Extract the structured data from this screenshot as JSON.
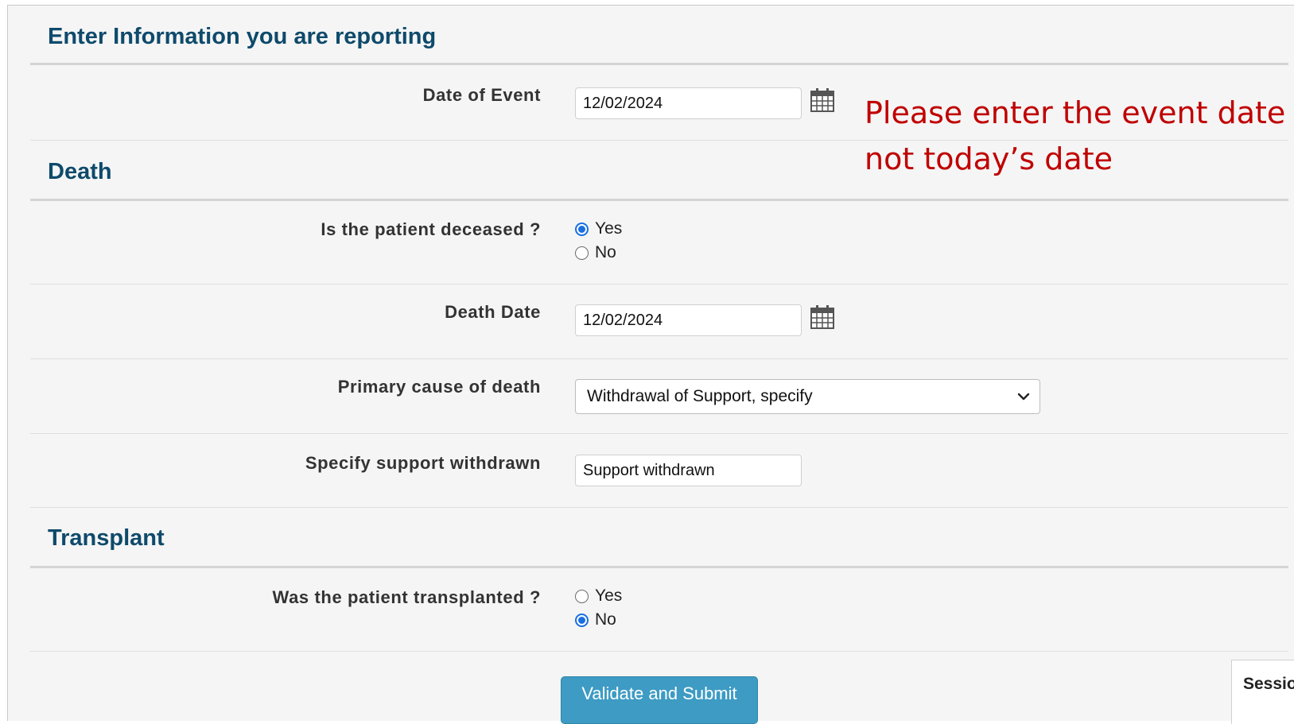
{
  "sections": {
    "reporting_title": "Enter Information you are reporting",
    "death_title": "Death",
    "transplant_title": "Transplant"
  },
  "fields": {
    "event_date": {
      "label": "Date of Event",
      "value": "12/02/2024"
    },
    "deceased": {
      "label": "Is the patient deceased ?",
      "options": [
        "Yes",
        "No"
      ],
      "selected": "Yes"
    },
    "death_date": {
      "label": "Death Date",
      "value": "12/02/2024"
    },
    "primary_cause": {
      "label": "Primary cause of death",
      "selected": "Withdrawal of Support, specify"
    },
    "support_withdrawn": {
      "label": "Specify support withdrawn",
      "value": "Support withdrawn"
    },
    "transplanted": {
      "label": "Was the patient transplanted ?",
      "options": [
        "Yes",
        "No"
      ],
      "selected": "No"
    }
  },
  "annotation": {
    "line1": "Please enter the event date",
    "line2": "not today’s date",
    "color": "#c00000"
  },
  "actions": {
    "submit_label": "Validate and Submit"
  },
  "session_panel": {
    "text": "Sessio"
  },
  "icons": {
    "calendar": "calendar-icon",
    "dropdown": "chevron-down-icon"
  },
  "colors": {
    "heading": "#0e4a6b",
    "button": "#3d9bc4",
    "radio_selected": "#1a6fe0"
  }
}
